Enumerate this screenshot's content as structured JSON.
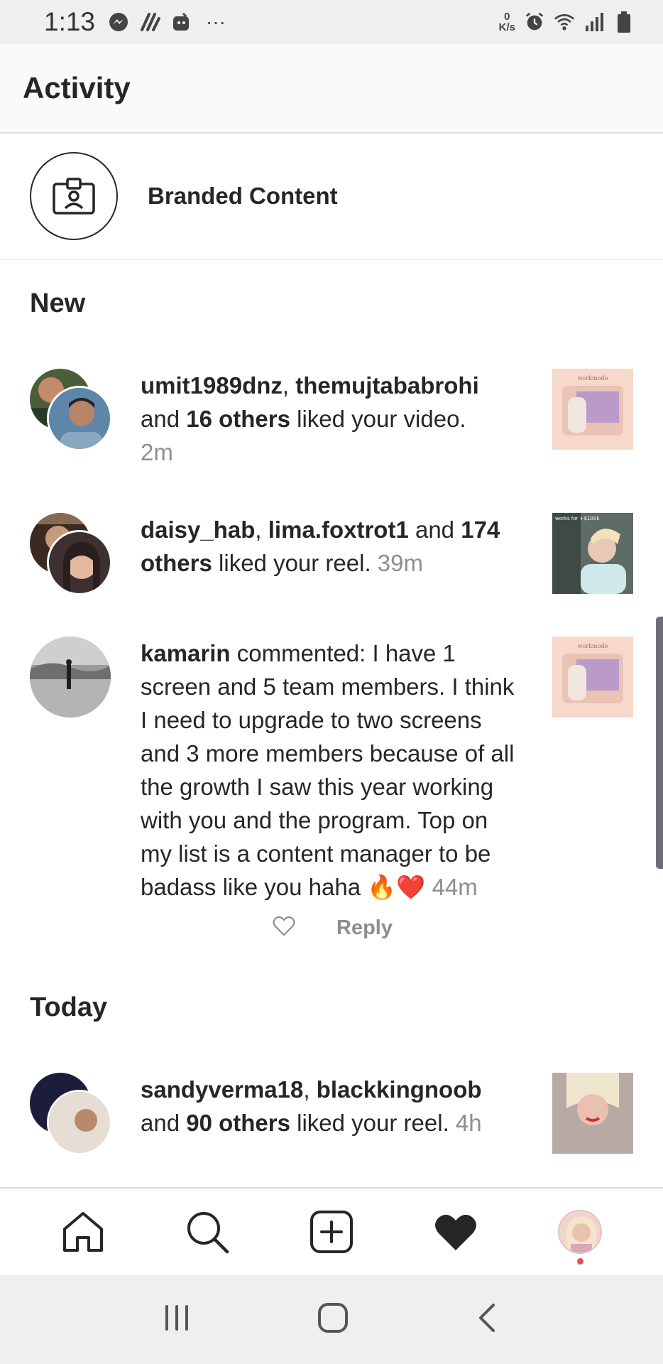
{
  "status_bar": {
    "time": "1:13",
    "more": "···",
    "net_speed_top": "0",
    "net_speed_bottom": "K/s"
  },
  "header": {
    "title": "Activity"
  },
  "branded_content": {
    "label": "Branded Content"
  },
  "sections": {
    "new": "New",
    "today": "Today"
  },
  "notifications": [
    {
      "user1": "umit1989dnz",
      "user2": "themujtababrohi",
      "mid": " and ",
      "others": "16 others",
      "action": " liked your video.",
      "time": "2m",
      "thumb_text": "workmode"
    },
    {
      "user1": "daisy_hab",
      "user2": "lima.foxtrot1",
      "mid": " and ",
      "others": "174 others",
      "action": " liked your reel.",
      "time": "39m",
      "thumb_text": "works for +$100k"
    },
    {
      "user": "kamarin",
      "comment": " commented: I have 1 screen and 5 team members. I think I need to upgrade to two screens and 3 more members because of all the growth I saw this year working with you and the program. Top on my list is a content manager to be badass like you haha ",
      "emoji": "🔥❤️",
      "time": "44m",
      "reply": "Reply",
      "thumb_text": "workmode"
    },
    {
      "user1": "sandyverma18",
      "user2": "blackkingnoob",
      "mid": " and ",
      "others": "90 others",
      "action": " liked your reel.",
      "time": "4h"
    }
  ],
  "colors": {
    "primary_text": "#262626",
    "secondary_text": "#8e8e8e",
    "divider": "#dbdbdb",
    "notification_dot": "#ed4956"
  },
  "bottom_nav": [
    "home-icon",
    "search-icon",
    "new-post-icon",
    "activity-heart-icon",
    "profile-avatar"
  ],
  "system_nav": [
    "recents-icon",
    "home-circle-icon",
    "back-icon"
  ]
}
